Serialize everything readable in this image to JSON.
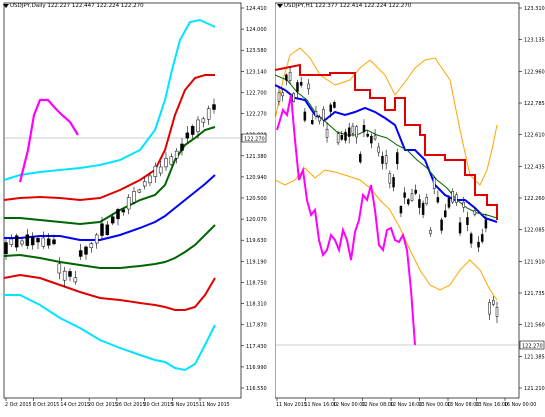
{
  "left_panel": {
    "title": "USDJPY,Daily 122.227 122.447 122.224 122.270",
    "price_labels": [
      "124.410",
      "124.000",
      "123.580",
      "123.140",
      "122.700",
      "122.270",
      "121.820",
      "121.380",
      "120.940",
      "120.500",
      "120.070",
      "119.630",
      "119.190",
      "118.750",
      "118.310",
      "117.870",
      "117.430",
      "116.990",
      "116.550"
    ],
    "current_price": "122.270",
    "date_labels": [
      "2 Oct 2015",
      "8 Oct 2015",
      "14 Oct 2015",
      "20 Oct 2015",
      "26 Oct 2015",
      "30 Oct 2015",
      "5 Nov 2015",
      "11 Nov 2015"
    ]
  },
  "right_panel": {
    "title": "USDJPY,H1 122.377 122.414 122.224 122.270",
    "price_labels": [
      "123.310",
      "123.135",
      "122.960",
      "122.785",
      "122.610",
      "122.435",
      "122.260",
      "122.085",
      "121.910",
      "121.735",
      "121.560",
      "121.385",
      "121.210"
    ],
    "current_price": "122.270",
    "date_labels": [
      "11 Nov 2015",
      "11 Nov 16:00",
      "12 Nov 00:00",
      "12 Nov 08:00",
      "12 Nov 16:00",
      "13 Nov 00:00",
      "13 Nov 08:00",
      "13 Nov 16:00",
      "16 Nov 00:00"
    ]
  },
  "colors": {
    "background": "#ffffff",
    "upper_band": "#00e5ff",
    "red_band": "#e00000",
    "green_line": "#006400",
    "blue_line": "#0000ff",
    "magenta_line": "#ff00ff",
    "orange_band": "#ffa500",
    "bull_candle": "#ffffff",
    "bear_candle": "#000000"
  }
}
